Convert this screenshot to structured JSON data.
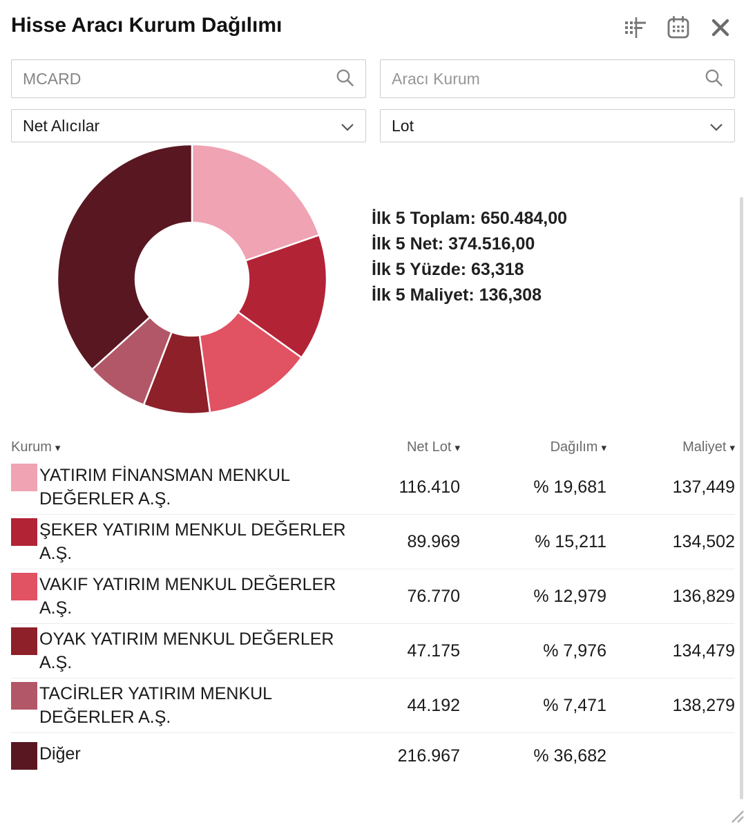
{
  "header": {
    "title": "Hisse Aracı Kurum Dağılımı",
    "icons": [
      "indicator-settings",
      "calendar",
      "close"
    ]
  },
  "filters": {
    "symbol_input": {
      "value": "MCARD",
      "icon": "search"
    },
    "broker_input": {
      "placeholder": "Aracı Kurum",
      "icon": "search"
    },
    "side_select": {
      "value": "Net Alıcılar"
    },
    "unit_select": {
      "value": "Lot"
    }
  },
  "summary": {
    "lines": [
      "İlk 5 Toplam: 650.484,00",
      "İlk 5 Net: 374.516,00",
      "İlk 5 Yüzde: 63,318",
      "İlk 5 Maliyet: 136,308"
    ]
  },
  "chart_data": {
    "type": "pie",
    "variant": "donut",
    "start_angle": "top",
    "direction": "clockwise",
    "inner_radius_ratio": 0.42,
    "labels": [
      "YATIRIM FİNANSMAN MENKUL DEĞERLER A.Ş.",
      "ŞEKER YATIRIM MENKUL DEĞERLER A.Ş.",
      "VAKIF YATIRIM MENKUL DEĞERLER A.Ş.",
      "OYAK YATIRIM MENKUL DEĞERLER A.Ş.",
      "TACİRLER YATIRIM MENKUL DEĞERLER A.Ş.",
      "Diğer"
    ],
    "values": [
      19.681,
      15.211,
      12.979,
      7.976,
      7.471,
      36.682
    ],
    "colors": [
      "#EFA3B3",
      "#B32336",
      "#E15263",
      "#8D2029",
      "#B25767",
      "#591722"
    ]
  },
  "table": {
    "sort_icon": "▾",
    "columns": [
      "Kurum",
      "Net Lot",
      "Dağılım",
      "Maliyet"
    ],
    "rows": [
      {
        "kurum": "YATIRIM FİNANSMAN MENKUL DEĞERLER A.Ş.",
        "color": "#EFA3B3",
        "net_lot": "116.410",
        "dagilim": "% 19,681",
        "maliyet": "137,449"
      },
      {
        "kurum": "ŞEKER YATIRIM MENKUL DEĞERLER A.Ş.",
        "color": "#B32336",
        "net_lot": "89.969",
        "dagilim": "% 15,211",
        "maliyet": "134,502"
      },
      {
        "kurum": "VAKIF YATIRIM MENKUL DEĞERLER A.Ş.",
        "color": "#E15263",
        "net_lot": "76.770",
        "dagilim": "% 12,979",
        "maliyet": "136,829"
      },
      {
        "kurum": "OYAK YATIRIM MENKUL DEĞERLER A.Ş.",
        "color": "#8D2029",
        "net_lot": "47.175",
        "dagilim": "% 7,976",
        "maliyet": "134,479"
      },
      {
        "kurum": "TACİRLER YATIRIM MENKUL DEĞERLER A.Ş.",
        "color": "#B25767",
        "net_lot": "44.192",
        "dagilim": "% 7,471",
        "maliyet": "138,279"
      },
      {
        "kurum": "Diğer",
        "color": "#591722",
        "net_lot": "216.967",
        "dagilim": "% 36,682",
        "maliyet": ""
      }
    ]
  },
  "colors": {
    "icon_gray": "#757575",
    "border_gray": "#cccccc",
    "row_divider": "#ececec"
  }
}
